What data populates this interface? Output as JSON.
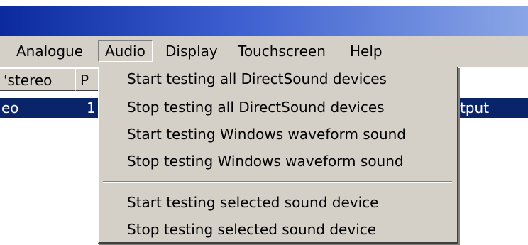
{
  "menubar": {
    "items": [
      "Analogue",
      "Audio",
      "Display",
      "Touchscreen",
      "Help"
    ]
  },
  "list": {
    "headers": [
      "'stereo",
      "P"
    ],
    "selected_row": {
      "cells": [
        "eo",
        "1",
        "tput"
      ]
    }
  },
  "audio_menu": {
    "group1": [
      "Start testing all DirectSound devices",
      "Stop testing all DirectSound devices",
      "Start testing Windows waveform sound",
      "Stop testing Windows waveform sound"
    ],
    "group2": [
      "Start testing selected sound device",
      "Stop testing selected sound device"
    ]
  },
  "colors": {
    "title_gradient_start": "#0a2a9e",
    "title_gradient_end": "#8aa6e6",
    "menu_bg": "#d4d0c8",
    "selection_bg": "#0a246a",
    "selection_text": "#ffffff"
  }
}
